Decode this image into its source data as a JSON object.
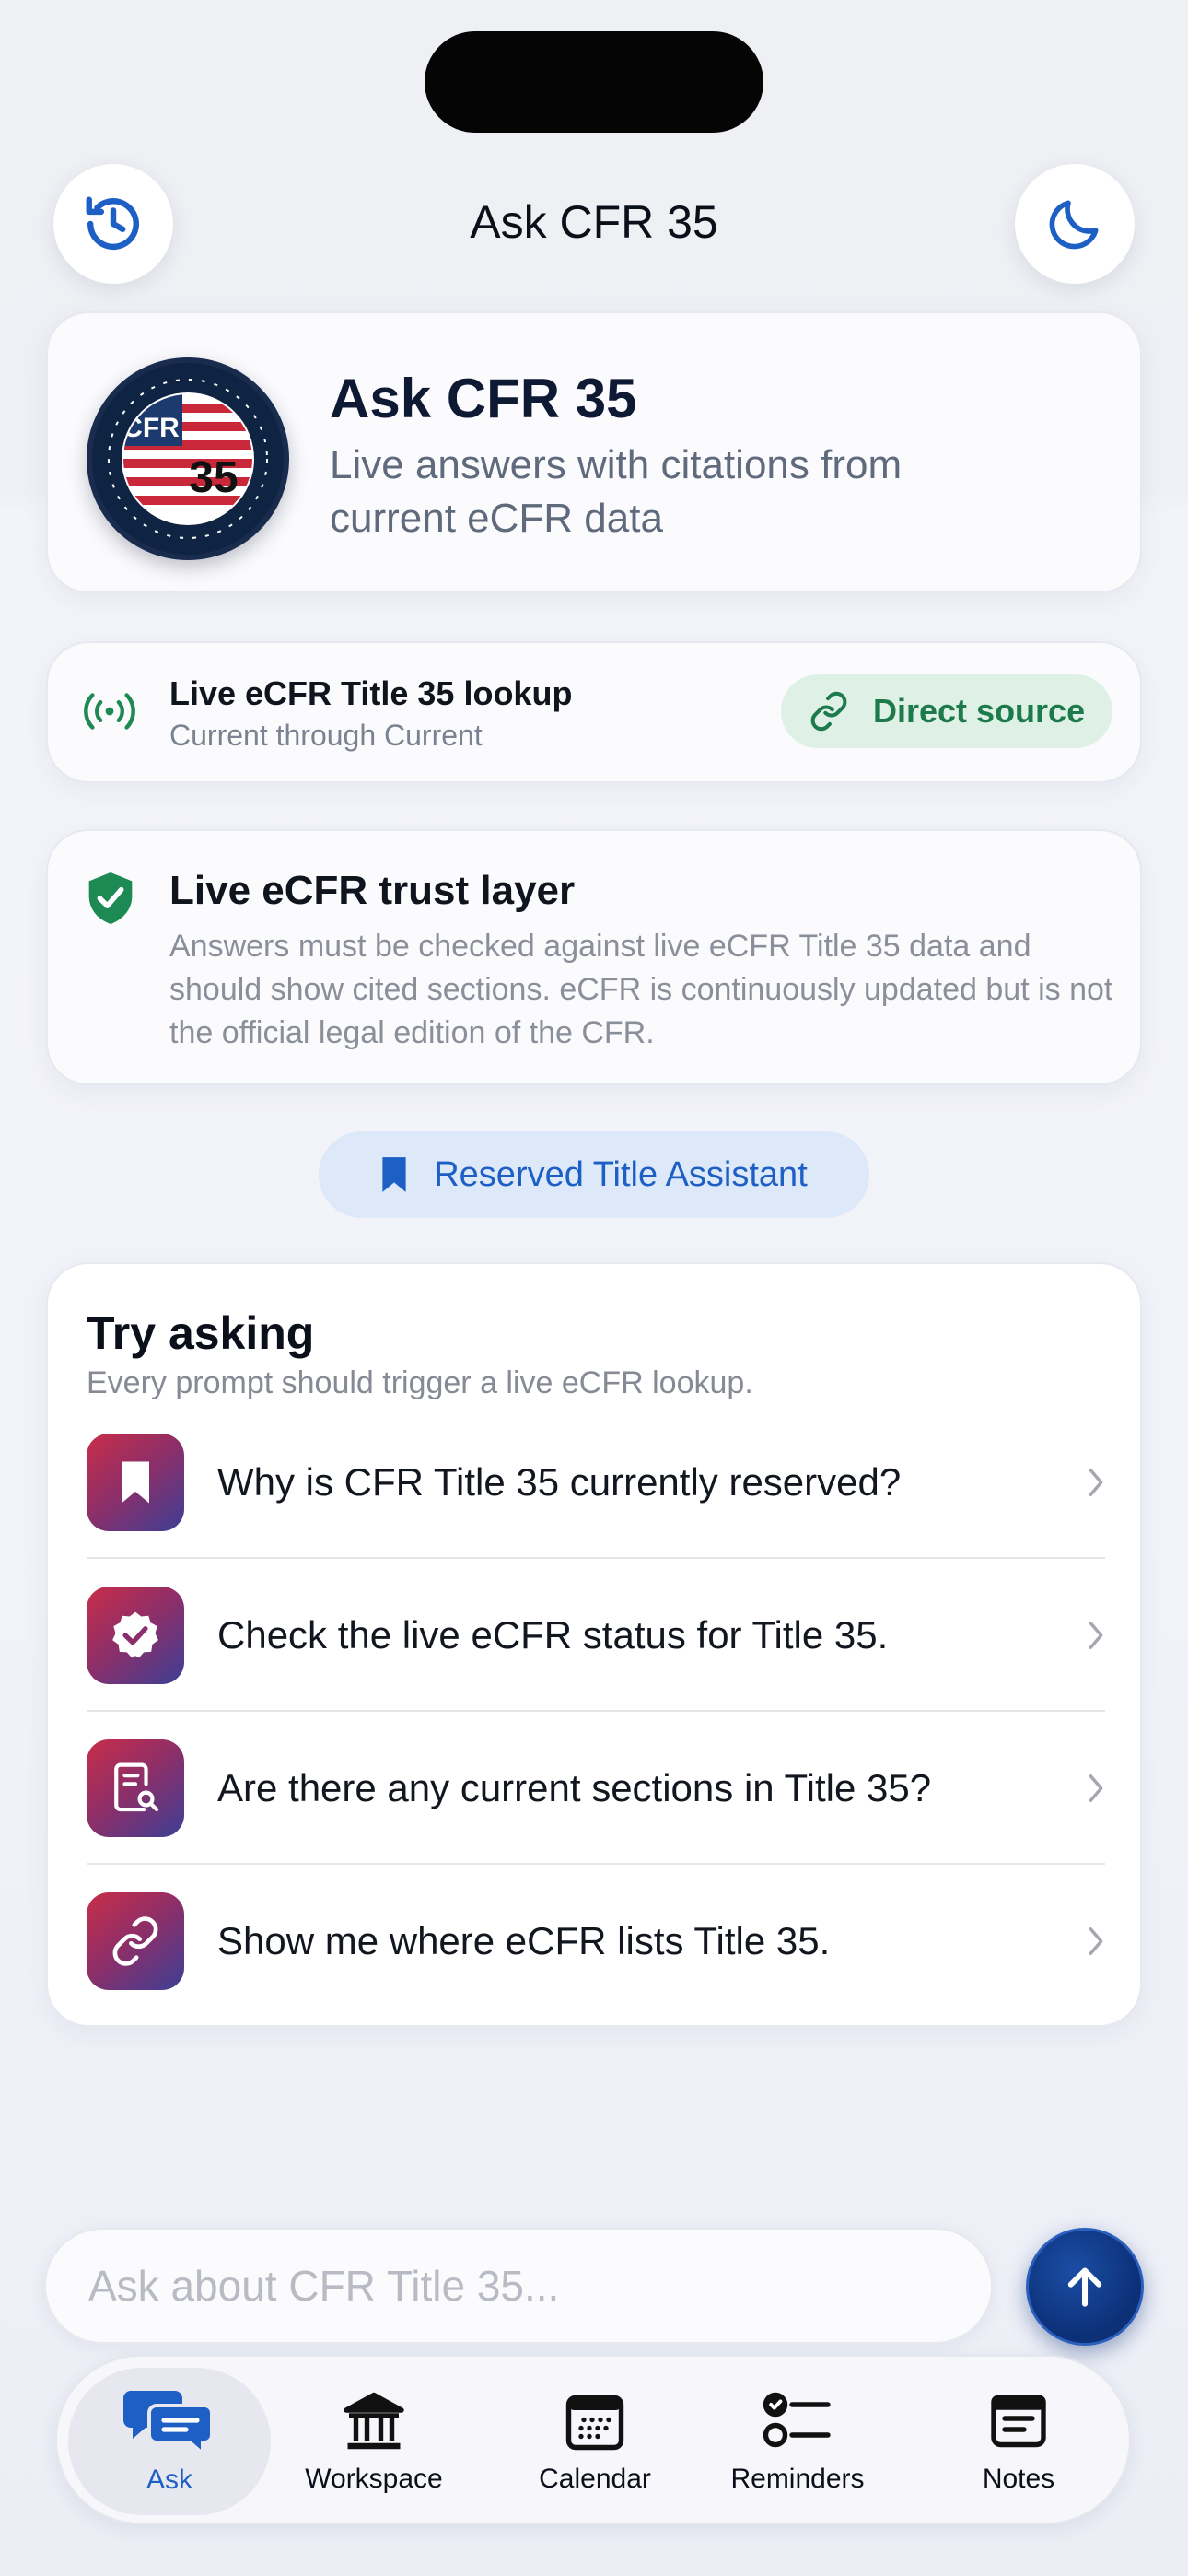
{
  "header": {
    "title": "Ask CFR 35"
  },
  "hero": {
    "title": "Ask CFR 35",
    "subtitle": "Live answers with citations from current eCFR data",
    "seal_text": "CFR",
    "seal_number": "35"
  },
  "lookup": {
    "title": "Live eCFR Title 35 lookup",
    "subtitle": "Current through Current",
    "button_label": "Direct source"
  },
  "trust": {
    "title": "Live eCFR trust layer",
    "body": "Answers must be checked against live eCFR Title 35 data and should show cited sections. eCFR is continuously updated but is not the official legal edition of the CFR."
  },
  "badge": {
    "label": "Reserved Title Assistant"
  },
  "try_asking": {
    "title": "Try asking",
    "subtitle": "Every prompt should trigger a live eCFR lookup.",
    "prompts": [
      {
        "text": "Why is CFR Title 35 currently reserved?",
        "icon": "bookmark-icon"
      },
      {
        "text": "Check the live eCFR status for Title 35.",
        "icon": "verified-badge-icon"
      },
      {
        "text": "Are there any current sections in Title 35?",
        "icon": "document-search-icon"
      },
      {
        "text": "Show me where eCFR lists Title 35.",
        "icon": "link-icon"
      }
    ]
  },
  "composer": {
    "placeholder": "Ask about CFR Title 35..."
  },
  "tabs": [
    {
      "label": "Ask",
      "icon": "chat-bubbles-icon",
      "active": true
    },
    {
      "label": "Workspace",
      "icon": "bank-icon",
      "active": false
    },
    {
      "label": "Calendar",
      "icon": "calendar-icon",
      "active": false
    },
    {
      "label": "Reminders",
      "icon": "checklist-icon",
      "active": false
    },
    {
      "label": "Notes",
      "icon": "note-icon",
      "active": false
    }
  ],
  "colors": {
    "accent": "#1d5fc4",
    "success": "#1c7a4b",
    "send_button": "#0c2f76"
  }
}
